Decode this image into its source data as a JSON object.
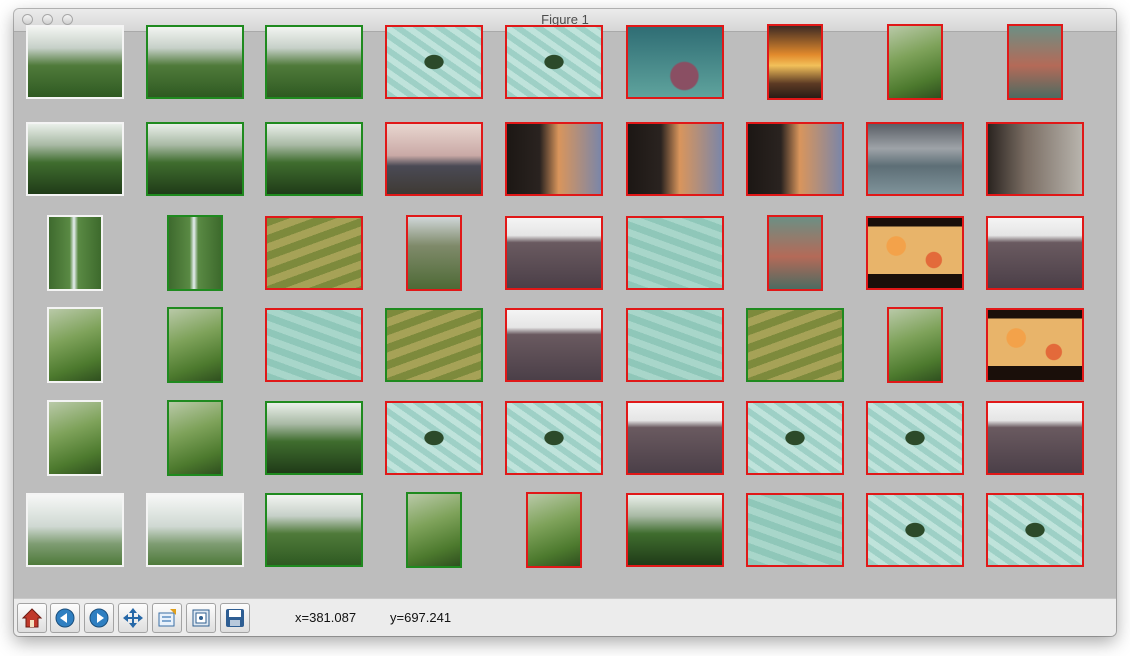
{
  "window": {
    "title": "Figure 1"
  },
  "toolbar": {
    "buttons": [
      {
        "icon": "home-icon"
      },
      {
        "icon": "back-icon"
      },
      {
        "icon": "forward-icon"
      },
      {
        "icon": "pan-icon"
      },
      {
        "icon": "zoom-to-rect-icon"
      },
      {
        "icon": "subplots-icon"
      },
      {
        "icon": "save-icon"
      }
    ],
    "x_coord": "x=381.087",
    "y_coord": "y=697.241"
  },
  "colors": {
    "query_border": "#f4f4f4",
    "match_border": "#1f8a1f",
    "mismatch_border": "#e01818",
    "figure_bg": "#bdbdbd"
  },
  "grid": {
    "rows": 6,
    "columns": 9,
    "cells": [
      [
        "white",
        "green",
        "green",
        "red",
        "red",
        "red",
        "red",
        "red",
        "red"
      ],
      [
        "white",
        "green",
        "green",
        "red",
        "red",
        "red",
        "red",
        "red",
        "red"
      ],
      [
        "white",
        "green",
        "red",
        "red",
        "red",
        "red",
        "red",
        "red",
        "red"
      ],
      [
        "white",
        "green",
        "red",
        "green",
        "red",
        "red",
        "green",
        "red",
        "red"
      ],
      [
        "white",
        "green",
        "green",
        "red",
        "red",
        "red",
        "red",
        "red",
        "red"
      ],
      [
        "white",
        "white",
        "green",
        "green",
        "red",
        "red",
        "red",
        "red",
        "red"
      ]
    ],
    "scenes": [
      [
        "valley",
        "valley",
        "valley",
        "fish",
        "fish",
        "coral",
        "sunset",
        "hillside",
        "reef"
      ],
      [
        "jungle",
        "jungle",
        "jungle",
        "harbor",
        "rocks-sunset",
        "rocks-sunset",
        "rocks-sunset",
        "seascape",
        "beach"
      ],
      [
        "waterfall",
        "waterfall",
        "terraces",
        "mountain",
        "lava",
        "underwater",
        "reef",
        "pizza",
        "lava"
      ],
      [
        "hillside",
        "hillside",
        "underwater",
        "terraces",
        "lava",
        "underwater",
        "terraces",
        "hillside",
        "pizza"
      ],
      [
        "hillside",
        "hillside",
        "jungle",
        "fish",
        "fish",
        "lava",
        "fish",
        "fish",
        "lava"
      ],
      [
        "misty-valley",
        "misty-valley",
        "valley",
        "hillside",
        "hillside",
        "jungle",
        "underwater",
        "fish",
        "fish"
      ]
    ]
  }
}
